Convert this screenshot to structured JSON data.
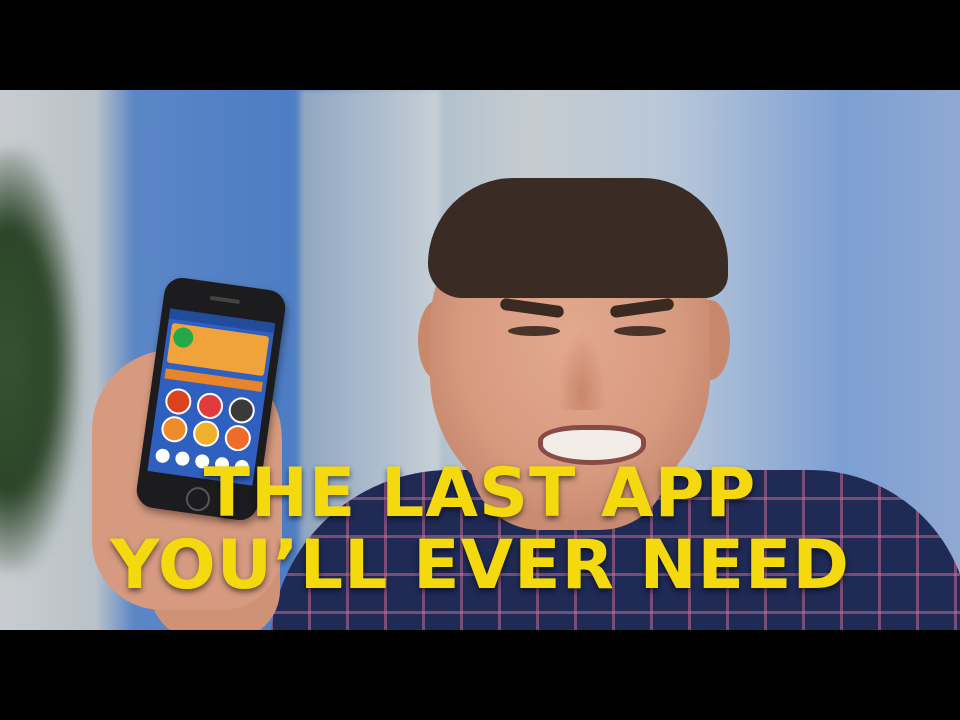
{
  "headline": {
    "line1": "THE LAST APP",
    "line2": "YOU’LL EVER NEED"
  },
  "colors": {
    "headline": "#f4d90e",
    "letterbox": "#000000",
    "background_blue": "#4d7dc4",
    "shirt": "#1f2a55",
    "phone_screen": "#2f5fbf",
    "app_panel": "#f1a33b"
  },
  "icons": [
    "play-icon",
    "app-button-icon",
    "media-control-icon"
  ]
}
